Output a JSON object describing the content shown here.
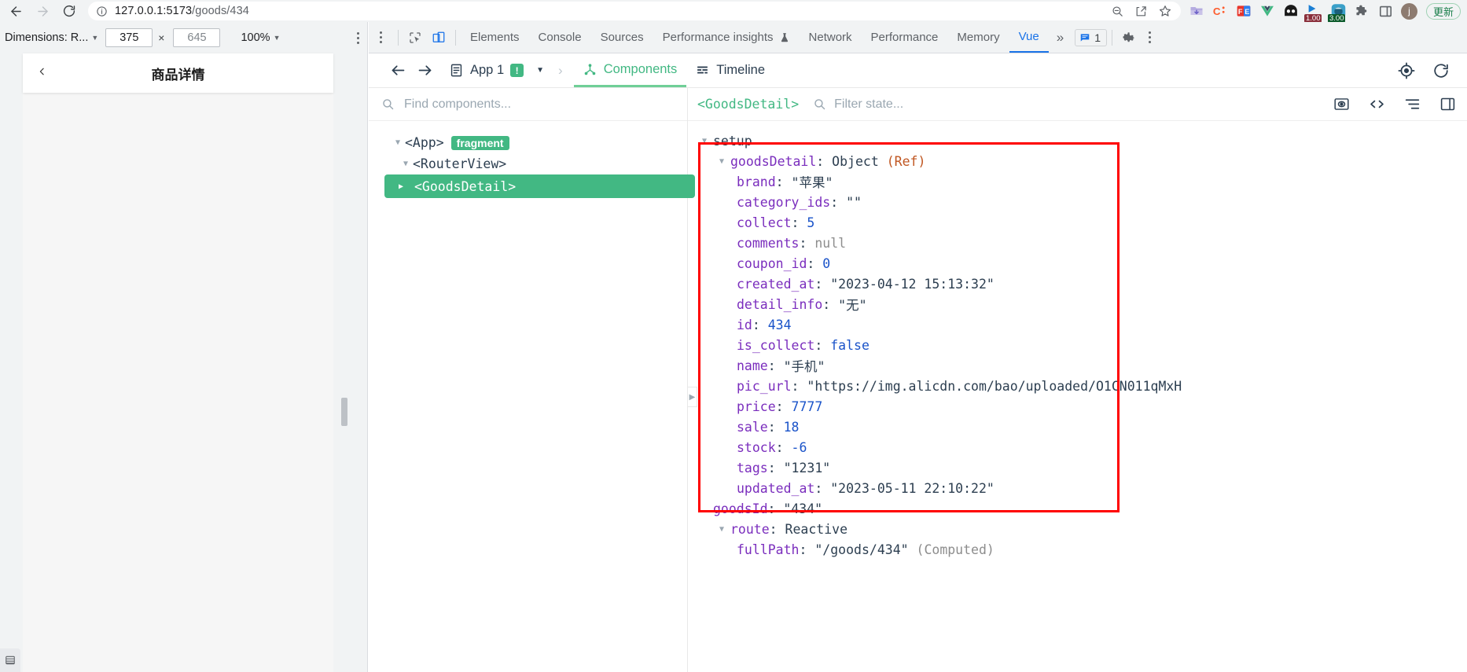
{
  "browser": {
    "url_main": "127.0.0.1:5173",
    "url_path": "/goods/434",
    "nav_back": "back-icon",
    "nav_forward": "forward-icon",
    "reload": "reload-icon",
    "site_info": "info-icon",
    "omnibox_icons": [
      "zoom-out-icon",
      "share-icon",
      "bookmark-star-icon"
    ],
    "extensions": [
      "download-folder-icon",
      "clickup-icon",
      "fe-helper-icon",
      "vue-devtools-icon",
      "momentum-icon",
      "video-speed-icon",
      "octotree-icon",
      "puzzle-extensions-icon",
      "sidepanel-icon"
    ],
    "ext_badge_1": "1.00",
    "ext_badge_2": "3.00",
    "profile_initial": "j",
    "update_button": "更新"
  },
  "device_toolbar": {
    "dimensions_label": "Dimensions: R...",
    "width_value": "375",
    "height_placeholder": "645",
    "multiply": "×",
    "zoom_value": "100%",
    "more_options": "more-options-icon"
  },
  "devtools": {
    "inspect_icon": "inspect-element-icon",
    "device_toggle_icon": "device-toolbar-icon",
    "tabs": [
      {
        "label": "Elements",
        "active": false
      },
      {
        "label": "Console",
        "active": false
      },
      {
        "label": "Sources",
        "active": false
      },
      {
        "label": "Performance insights",
        "active": false,
        "suffix_icon": "beaker-icon"
      },
      {
        "label": "Network",
        "active": false
      },
      {
        "label": "Performance",
        "active": false
      },
      {
        "label": "Memory",
        "active": false
      },
      {
        "label": "Vue",
        "active": true
      }
    ],
    "overflow": "»",
    "issues_count": "1",
    "issues_icon": "issues-message-icon",
    "settings_icon": "gear-icon",
    "more_icon": "more-vertical-icon"
  },
  "page": {
    "back_icon": "back-chevron-icon",
    "title": "商品详情",
    "resize_handle": "viewport-resize-handle",
    "console_drawer_icon": "console-drawer-icon"
  },
  "vue": {
    "nav_back_icon": "arrow-left-icon",
    "nav_forward_icon": "arrow-right-icon",
    "app_icon": "app-document-icon",
    "app_name": "App 1",
    "warning_badge": "!",
    "app_dropdown_icon": "chevron-down-icon",
    "breadcrumb_sep": "›",
    "tabs": [
      {
        "label": "Components",
        "icon": "components-tree-icon",
        "active": true
      },
      {
        "label": "Timeline",
        "icon": "timeline-icon",
        "active": false
      }
    ],
    "toolbar_right": [
      "target-select-icon",
      "refresh-icon"
    ],
    "find_placeholder": "Find components...",
    "find_icon": "search-icon",
    "selected_component": "<GoodsDetail>",
    "filter_placeholder": "Filter state...",
    "filter_icon": "search-icon",
    "state_tools": [
      "eye-inspect-icon",
      "code-brackets-icon",
      "collapse-all-icon",
      "open-panel-icon"
    ],
    "tree": [
      {
        "indent": 0,
        "arrow": "down",
        "label": "<App>",
        "chip": "fragment",
        "selected": false
      },
      {
        "indent": 1,
        "arrow": "down",
        "label": "<RouterView>",
        "chip": null,
        "selected": false
      },
      {
        "indent": 2,
        "arrow": "right",
        "label": "<GoodsDetail>",
        "chip": null,
        "selected": true
      }
    ],
    "state": {
      "setup_label": "setup",
      "root_key": "goodsDetail",
      "root_type": "Object",
      "root_ref": "(Ref)",
      "props": [
        {
          "key": "brand",
          "value": "\"苹果\"",
          "type": "str"
        },
        {
          "key": "category_ids",
          "value": "\"\"",
          "type": "str"
        },
        {
          "key": "collect",
          "value": "5",
          "type": "num"
        },
        {
          "key": "comments",
          "value": "null",
          "type": "null"
        },
        {
          "key": "coupon_id",
          "value": "0",
          "type": "num"
        },
        {
          "key": "created_at",
          "value": "\"2023-04-12 15:13:32\"",
          "type": "str"
        },
        {
          "key": "detail_info",
          "value": "\"无\"",
          "type": "str"
        },
        {
          "key": "id",
          "value": "434",
          "type": "num"
        },
        {
          "key": "is_collect",
          "value": "false",
          "type": "bool"
        },
        {
          "key": "name",
          "value": "\"手机\"",
          "type": "str"
        },
        {
          "key": "pic_url",
          "value": "\"https://img.alicdn.com/bao/uploaded/O1CN011qMxH",
          "type": "str"
        },
        {
          "key": "price",
          "value": "7777",
          "type": "num"
        },
        {
          "key": "sale",
          "value": "18",
          "type": "num"
        },
        {
          "key": "stock",
          "value": "-6",
          "type": "num"
        },
        {
          "key": "tags",
          "value": "\"1231\"",
          "type": "str"
        },
        {
          "key": "updated_at",
          "value": "\"2023-05-11 22:10:22\"",
          "type": "str"
        }
      ],
      "goods_id_key": "goodsId",
      "goods_id_value": "\"434\"",
      "route_key": "route",
      "route_type": "Reactive",
      "full_path_key": "fullPath",
      "full_path_value": "\"/goods/434\"",
      "full_path_computed": "(Computed)"
    },
    "highlight_color": "#ff0000",
    "accent_color": "#42b883"
  }
}
